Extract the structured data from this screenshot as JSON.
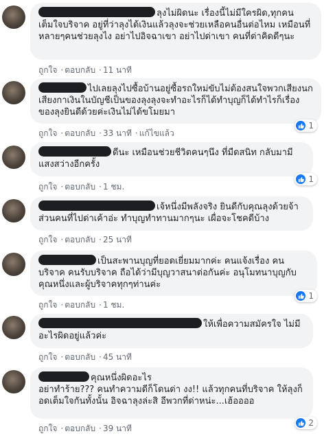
{
  "comments": [
    {
      "text": "ลุงไม่ผิดนะ เรื่องนี้ไม่มีใครผิด,ทุกคนเต็มใจบริจาค อยู่ที่ว่าลุงได้เงินแล้วลุงจะช่วยเหลือคนอื่นต่อไหม เหมือนที่หลายๆคนช่วยลุงไง อย่าไปอิจฉาเขา อย่าไปด่าเขา คนที่ด่าคิดดีๆนะ",
      "like": "ถูกใจ",
      "reply": "ตอบกลับ",
      "time": "11 นาที"
    },
    {
      "text": "ไปเลยลุงไปซื้อบ้านอยู่ซื้อรถใหม่ขับไม่ต้องสนใจพวกเสียงนกเสียงกาเงินในบัญชีเป็นของลุงลุงจะทำอะไรก็ได้ทำบุญก็ได้ทำไรก็เรื่องของลุงยินดีด้วยค่ะเงินไม่ได้ขโมยมา",
      "like": "ถูกใจ",
      "reply": "ตอบกลับ",
      "time": "33 นาที",
      "edited": "แก้ไขแล้ว",
      "reactions": "1"
    },
    {
      "text": "ดีนะ เหมือนช่วยชีวิตคนๆนึง ที่มืดสนิท กลับมามีแสงสว่างอีกครั้ง",
      "like": "ถูกใจ",
      "reply": "ตอบกลับ",
      "time": "1 ชม.",
      "reactions": "1"
    },
    {
      "text": "เจ้หนึ่งมีพลังจริง ยินดีกับคุณลุงด้วยจ้า ส่วนคนที่ไปด่าเค้าอ่ะ ทำบุญทำทานมากๆนะ เผื่อจะโชคดีบ้าง",
      "like": "ถูกใจ",
      "reply": "ตอบกลับ",
      "time": "25 นาที"
    },
    {
      "text": "เป็นสะพานบุญที่ยอดเยี่ยมมากค่ะ คนแจ้งเรื่อง คนบริจาค คนรับบริจาค ถือได้ว่ามีบุญวาสนาต่อกันค่ะ อนุโมทนาบุญกับคุณหนึ่งและผู้บริจาคทุกๆท่านค่ะ",
      "like": "ถูกใจ",
      "reply": "ตอบกลับ",
      "time": "1 ชม.",
      "reactions": "1"
    },
    {
      "text": "ให้เพื่อความสมัครใจ ไม่มีอะไรผิดอยู่แล้วค่ะ",
      "like": "ถูกใจ",
      "reply": "ตอบกลับ",
      "time": "45 นาที"
    },
    {
      "text_line1": "คุณหนึ่งผิดอะไร",
      "text_rest": "อย่าทำร้าย??? คนทำความดีก็โดนด่า งง!! แล้วทุกคนที่บริจาค ให้ลุงก็อดเต็มใจกันทั้งนั้น อิจฉาลุงล่ะสิ อีพวกที่ด่าหน่ะ...เฮ้ออออ",
      "like": "ถูกใจ",
      "reply": "ตอบกลับ",
      "time": "39 นาที",
      "reactions": "2"
    }
  ],
  "separator": "·",
  "colors": {
    "like_blue": "#1877f2",
    "bubble_bg": "#f2f3f5",
    "meta": "#606770"
  }
}
